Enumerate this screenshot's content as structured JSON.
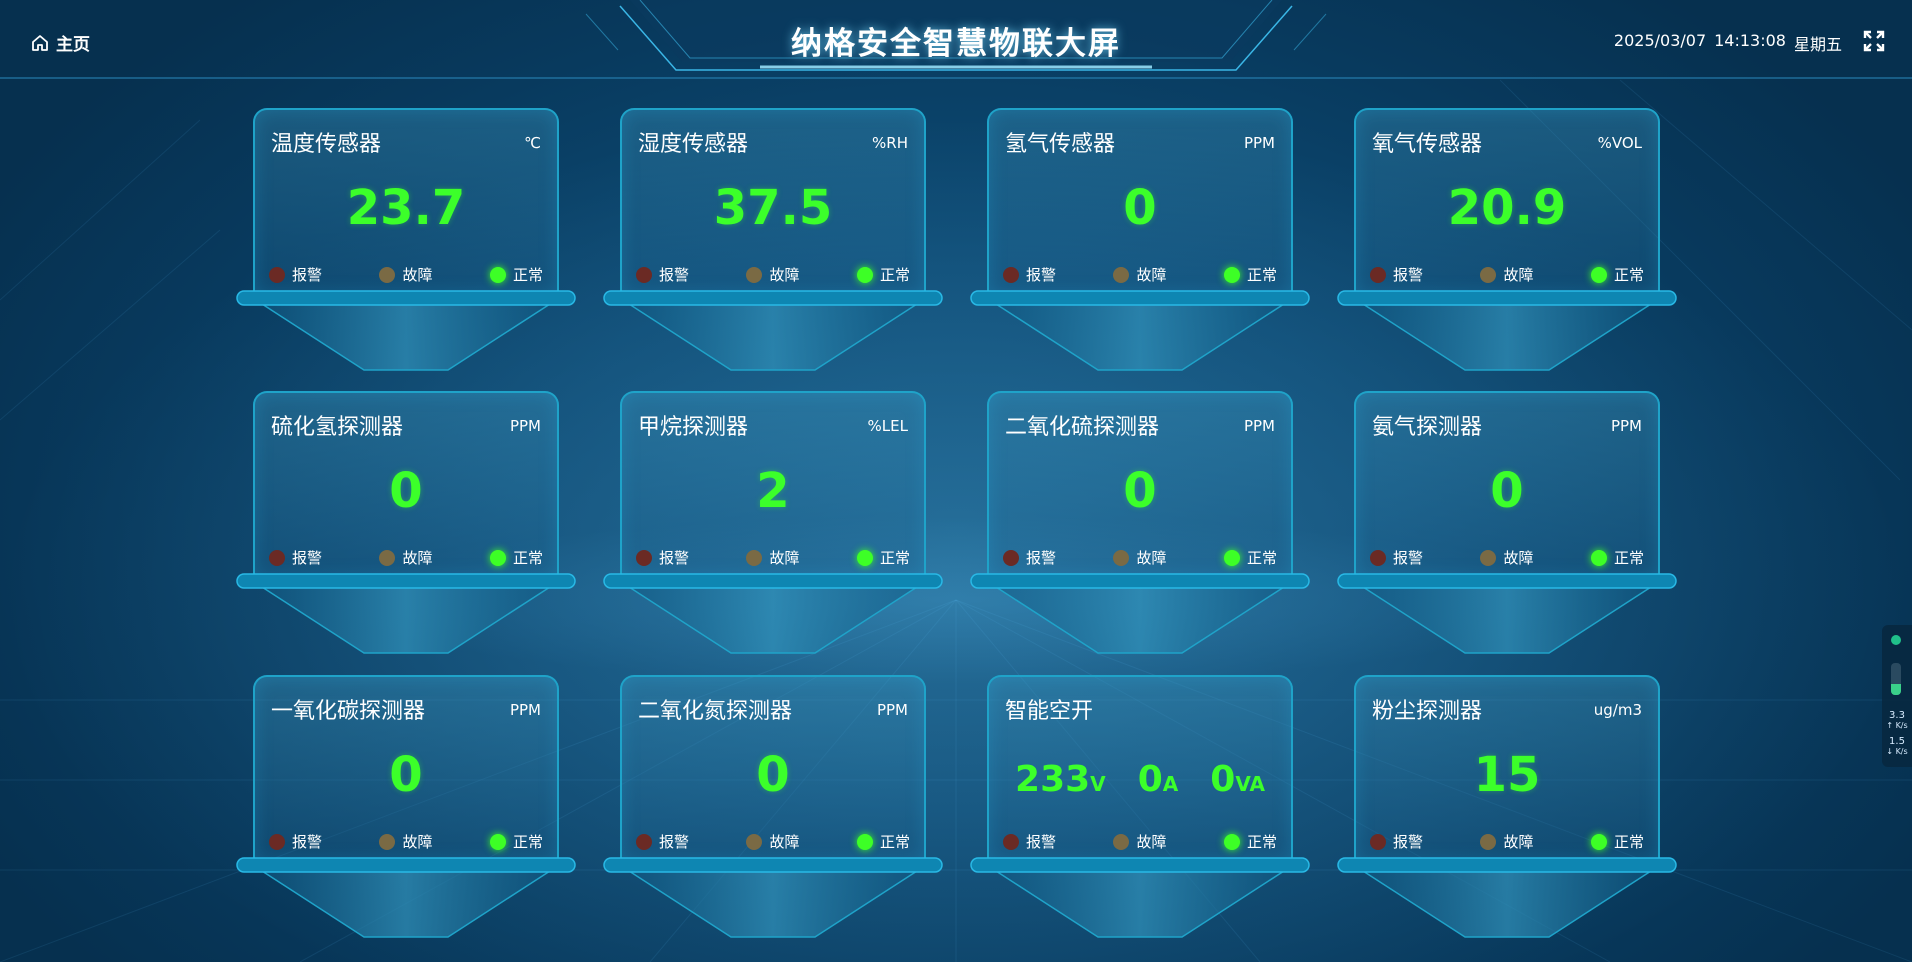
{
  "header": {
    "home_label": "主页",
    "title": "纳格安全智慧物联大屏",
    "date": "2025/03/07",
    "time": "14:13:08",
    "weekday": "星期五"
  },
  "status_labels": {
    "alarm": "报警",
    "fault": "故障",
    "normal": "正常"
  },
  "colors": {
    "value": "#3cff2a",
    "normal_dot": "#3dff26",
    "alarm_dot": "#6b2a24",
    "fault_dot": "#7a6a44",
    "card_border": "#1fa3c9"
  },
  "cards": [
    {
      "name": "温度传感器",
      "unit": "℃",
      "value": "23.7"
    },
    {
      "name": "湿度传感器",
      "unit": "%RH",
      "value": "37.5"
    },
    {
      "name": "氢气传感器",
      "unit": "PPM",
      "value": "0"
    },
    {
      "name": "氧气传感器",
      "unit": "%VOL",
      "value": "20.9"
    },
    {
      "name": "硫化氢探测器",
      "unit": "PPM",
      "value": "0"
    },
    {
      "name": "甲烷探测器",
      "unit": "%LEL",
      "value": "2"
    },
    {
      "name": "二氧化硫探测器",
      "unit": "PPM",
      "value": "0"
    },
    {
      "name": "氨气探测器",
      "unit": "PPM",
      "value": "0"
    },
    {
      "name": "一氧化碳探测器",
      "unit": "PPM",
      "value": "0"
    },
    {
      "name": "二氧化氮探测器",
      "unit": "PPM",
      "value": "0"
    },
    {
      "name": "智能空开",
      "unit": "",
      "value": "",
      "multi": [
        {
          "value": "233",
          "unit": "V"
        },
        {
          "value": "0",
          "unit": "A"
        },
        {
          "value": "0",
          "unit": "VA"
        }
      ]
    },
    {
      "name": "粉尘探测器",
      "unit": "ug/m3",
      "value": "15"
    }
  ],
  "side_widget": {
    "upload": "3.3",
    "upload_unit": "K/s",
    "download": "1.5",
    "download_unit": "K/s",
    "level": 0.35
  }
}
